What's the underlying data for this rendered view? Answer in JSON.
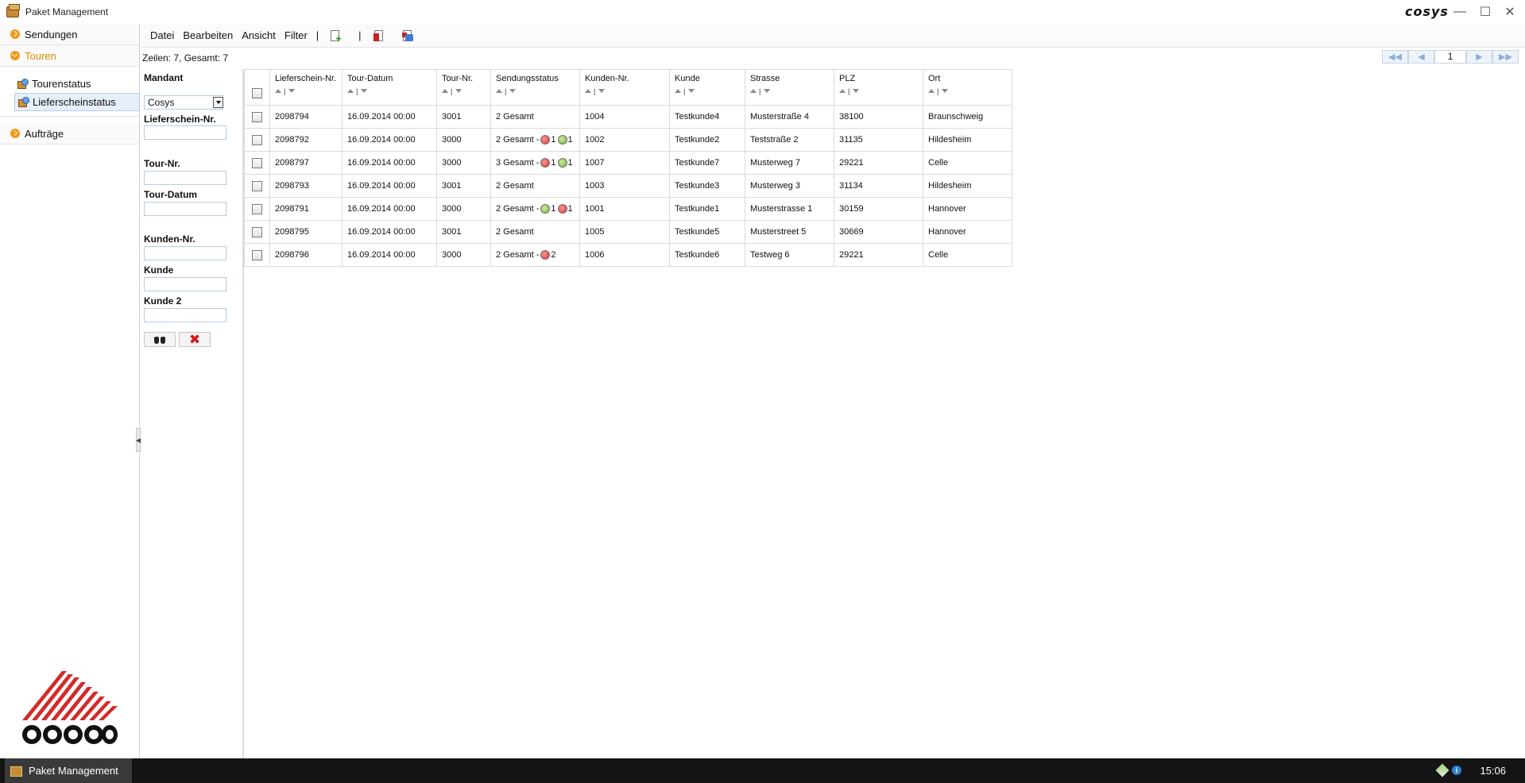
{
  "window": {
    "title": "Paket Management",
    "brand": "cosys"
  },
  "nav": {
    "sections": [
      {
        "label": "Sendungen"
      },
      {
        "label": "Touren"
      },
      {
        "label": "Aufträge"
      }
    ],
    "touren_items": [
      {
        "label": "Tourenstatus"
      },
      {
        "label": "Lieferscheinstatus"
      }
    ]
  },
  "menu": {
    "items": [
      "Datei",
      "Bearbeiten",
      "Ansicht",
      "Filter"
    ],
    "separator": "|"
  },
  "status": {
    "rows_text": "Zeilen: 7, Gesamt: 7"
  },
  "pager": {
    "page": "1"
  },
  "filter": {
    "mandant_label": "Mandant",
    "mandant_value": "Cosys",
    "lieferschein_label": "Lieferschein-Nr.",
    "tour_nr_label": "Tour-Nr.",
    "tour_datum_label": "Tour-Datum",
    "kunden_nr_label": "Kunden-Nr.",
    "kunde_label": "Kunde",
    "kunde2_label": "Kunde 2"
  },
  "table": {
    "columns": [
      "Lieferschein-Nr.",
      "Tour-Datum",
      "Tour-Nr.",
      "Sendungsstatus",
      "Kunden-Nr.",
      "Kunde",
      "Strasse",
      "PLZ",
      "Ort"
    ],
    "rows": [
      {
        "ls": "2098794",
        "datum": "16.09.2014 00:00",
        "tour": "3001",
        "status": "2 Gesamt",
        "badges": [],
        "kdnr": "1004",
        "kunde": "Testkunde4",
        "strasse": "Musterstraße 4",
        "plz": "38100",
        "ort": "Braunschweig"
      },
      {
        "ls": "2098792",
        "datum": "16.09.2014 00:00",
        "tour": "3000",
        "status": "2 Gesamt -",
        "badges": [
          {
            "color": "red",
            "count": "1"
          },
          {
            "color": "green",
            "count": "1"
          }
        ],
        "kdnr": "1002",
        "kunde": "Testkunde2",
        "strasse": "Teststraße 2",
        "plz": "31135",
        "ort": "Hildesheim"
      },
      {
        "ls": "2098797",
        "datum": "16.09.2014 00:00",
        "tour": "3000",
        "status": "3 Gesamt -",
        "badges": [
          {
            "color": "red",
            "count": "1"
          },
          {
            "color": "green",
            "count": "1"
          }
        ],
        "kdnr": "1007",
        "kunde": "Testkunde7",
        "strasse": "Musterweg 7",
        "plz": "29221",
        "ort": "Celle"
      },
      {
        "ls": "2098793",
        "datum": "16.09.2014 00:00",
        "tour": "3001",
        "status": "2 Gesamt",
        "badges": [],
        "kdnr": "1003",
        "kunde": "Testkunde3",
        "strasse": "Musterweg 3",
        "plz": "31134",
        "ort": "Hildesheim"
      },
      {
        "ls": "2098791",
        "datum": "16.09.2014 00:00",
        "tour": "3000",
        "status": "2 Gesamt -",
        "badges": [
          {
            "color": "green",
            "count": "1"
          },
          {
            "color": "red",
            "count": "1"
          }
        ],
        "kdnr": "1001",
        "kunde": "Testkunde1",
        "strasse": "Musterstrasse 1",
        "plz": "30159",
        "ort": "Hannover"
      },
      {
        "ls": "2098795",
        "datum": "16.09.2014 00:00",
        "tour": "3001",
        "status": "2 Gesamt",
        "badges": [],
        "kdnr": "1005",
        "kunde": "Testkunde5",
        "strasse": "Musterstreet 5",
        "plz": "30669",
        "ort": "Hannover"
      },
      {
        "ls": "2098796",
        "datum": "16.09.2014 00:00",
        "tour": "3000",
        "status": "2 Gesamt -",
        "badges": [
          {
            "color": "red",
            "count": "2"
          }
        ],
        "kdnr": "1006",
        "kunde": "Testkunde6",
        "strasse": "Testweg 6",
        "plz": "29221",
        "ort": "Celle"
      }
    ]
  },
  "taskbar": {
    "app_label": "Paket Management",
    "time": "15:06"
  },
  "colors": {
    "accent": "#e08a00",
    "brand_red": "#d22a2a",
    "selection": "#e6eef9"
  }
}
